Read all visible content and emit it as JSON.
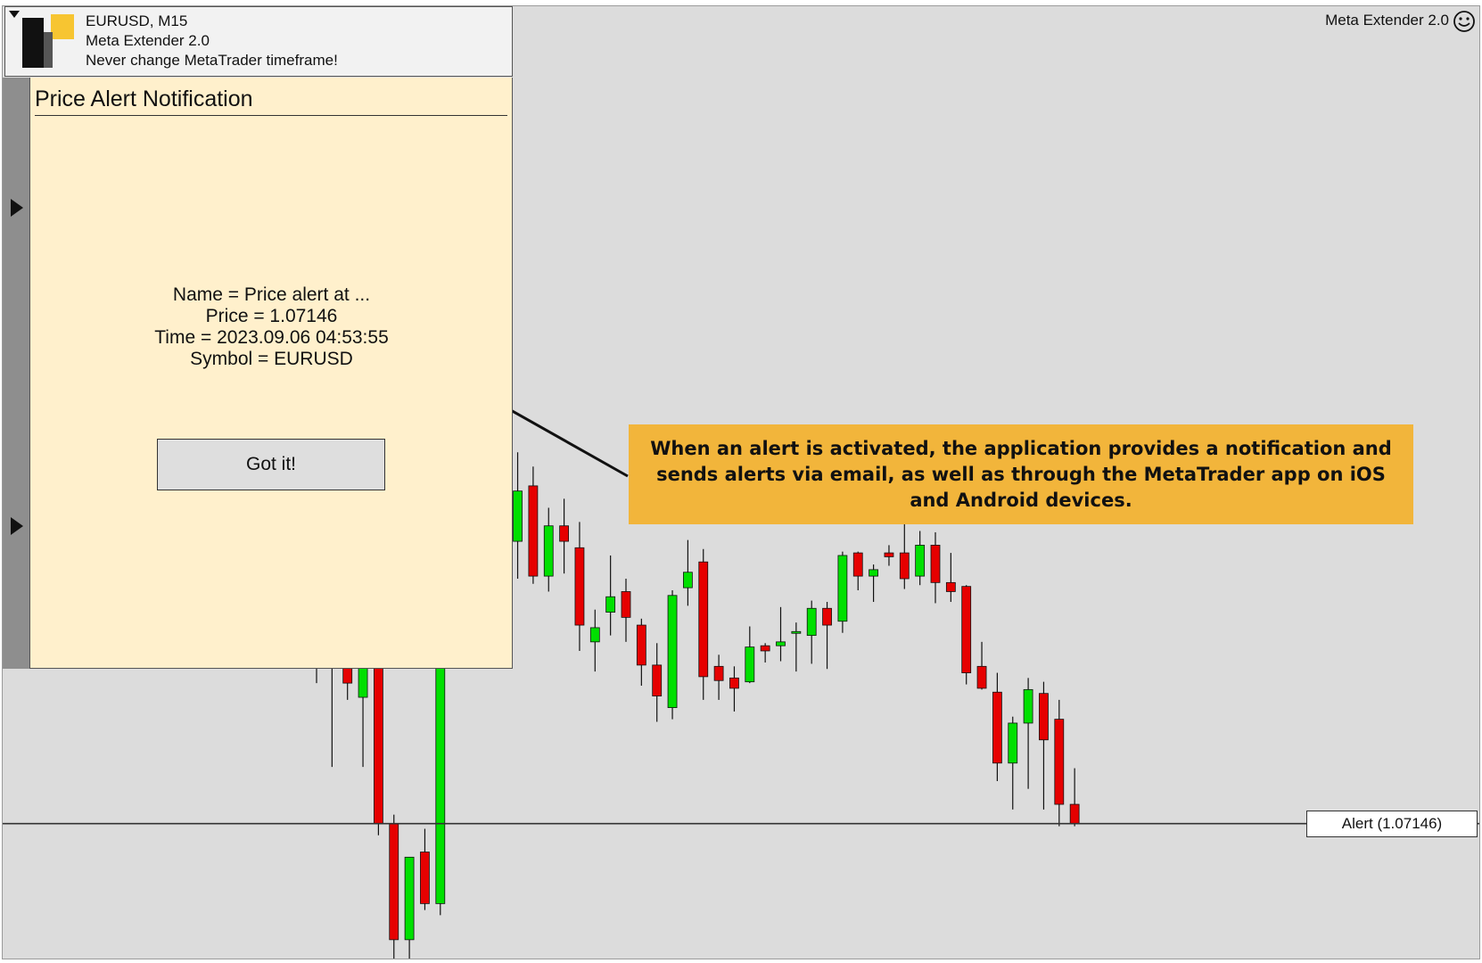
{
  "info_box": {
    "symbol_timeframe": "EURUSD, M15",
    "app_name": "Meta Extender 2.0",
    "tagline": "Never change MetaTrader timeframe!"
  },
  "top_right": {
    "brand": "Meta Extender 2.0",
    "icon": "smiley-icon"
  },
  "alert_panel": {
    "title": "Price Alert Notification",
    "details": [
      "Name = Price alert at ...",
      "Price = 1.07146",
      "Time = 2023.09.06 04:53:55",
      "Symbol = EURUSD"
    ],
    "button_label": "Got it!"
  },
  "callout": {
    "text": "When an alert is activated, the application provides a notification and sends alerts via email, as well as through the MetaTrader app on iOS and Android devices."
  },
  "alert_line": {
    "label": "Alert (1.07146)",
    "price": 1.07146
  },
  "colors": {
    "bull_candle": "#00e000",
    "bear_candle": "#e60000",
    "chart_background": "#dcdcdc",
    "panel_background": "#fff0cc",
    "callout_background": "#f2b53b"
  },
  "chart_data": {
    "type": "candlestick",
    "symbol": "EURUSD",
    "timeframe": "M15",
    "ylim": [
      1.0704,
      1.0778
    ],
    "candles": [
      {
        "o": 1.07368,
        "h": 1.07413,
        "l": 1.07255,
        "c": 1.073
      },
      {
        "o": 1.073,
        "h": 1.0736,
        "l": 1.0719,
        "c": 1.07323
      },
      {
        "o": 1.07379,
        "h": 1.0739,
        "l": 1.07242,
        "c": 1.07255
      },
      {
        "o": 1.07244,
        "h": 1.07322,
        "l": 1.0719,
        "c": 1.07314
      },
      {
        "o": 1.07311,
        "h": 1.07322,
        "l": 1.07137,
        "c": 1.07146
      },
      {
        "o": 1.07146,
        "h": 1.07153,
        "l": 1.0704,
        "c": 1.07056
      },
      {
        "o": 1.07056,
        "h": 1.0712,
        "l": 1.0704,
        "c": 1.0712
      },
      {
        "o": 1.07124,
        "h": 1.07142,
        "l": 1.07079,
        "c": 1.07084
      },
      {
        "o": 1.07084,
        "h": 1.073,
        "l": 1.07075,
        "c": 1.0728
      },
      {
        "o": 1.0728,
        "h": 1.07436,
        "l": 1.07276,
        "c": 1.07368
      },
      {
        "o": 1.07368,
        "h": 1.07414,
        "l": 1.07338,
        "c": 1.07376
      },
      {
        "o": 1.07372,
        "h": 1.07414,
        "l": 1.07343,
        "c": 1.07352
      },
      {
        "o": 1.07354,
        "h": 1.07382,
        "l": 1.07324,
        "c": 1.07365
      },
      {
        "o": 1.07365,
        "h": 1.07434,
        "l": 1.07336,
        "c": 1.07404
      },
      {
        "o": 1.07408,
        "h": 1.07423,
        "l": 1.07332,
        "c": 1.07338
      },
      {
        "o": 1.07338,
        "h": 1.07391,
        "l": 1.07326,
        "c": 1.07377
      },
      {
        "o": 1.07377,
        "h": 1.07398,
        "l": 1.0734,
        "c": 1.07365
      },
      {
        "o": 1.0736,
        "h": 1.0738,
        "l": 1.0728,
        "c": 1.073
      },
      {
        "o": 1.07287,
        "h": 1.07312,
        "l": 1.07264,
        "c": 1.07298
      },
      {
        "o": 1.0731,
        "h": 1.07354,
        "l": 1.07292,
        "c": 1.07322
      },
      {
        "o": 1.07326,
        "h": 1.07336,
        "l": 1.07287,
        "c": 1.07306
      },
      {
        "o": 1.073,
        "h": 1.07305,
        "l": 1.07253,
        "c": 1.07269
      },
      {
        "o": 1.07269,
        "h": 1.07286,
        "l": 1.07225,
        "c": 1.07245
      },
      {
        "o": 1.07236,
        "h": 1.07327,
        "l": 1.07227,
        "c": 1.07323
      },
      {
        "o": 1.07329,
        "h": 1.07366,
        "l": 1.07315,
        "c": 1.07341
      },
      {
        "o": 1.07349,
        "h": 1.07359,
        "l": 1.07242,
        "c": 1.0726
      },
      {
        "o": 1.07268,
        "h": 1.07277,
        "l": 1.07242,
        "c": 1.07257
      },
      {
        "o": 1.07259,
        "h": 1.07268,
        "l": 1.07233,
        "c": 1.07251
      },
      {
        "o": 1.07256,
        "h": 1.07299,
        "l": 1.07255,
        "c": 1.07283
      },
      {
        "o": 1.07284,
        "h": 1.07286,
        "l": 1.07271,
        "c": 1.0728
      },
      {
        "o": 1.07284,
        "h": 1.07314,
        "l": 1.07272,
        "c": 1.07287
      },
      {
        "o": 1.07295,
        "h": 1.07302,
        "l": 1.07264,
        "c": 1.07295
      },
      {
        "o": 1.07292,
        "h": 1.07319,
        "l": 1.0727,
        "c": 1.07313
      },
      {
        "o": 1.07313,
        "h": 1.07318,
        "l": 1.07266,
        "c": 1.073
      },
      {
        "o": 1.07303,
        "h": 1.07357,
        "l": 1.07294,
        "c": 1.07354
      },
      {
        "o": 1.07356,
        "h": 1.07357,
        "l": 1.07327,
        "c": 1.07338
      },
      {
        "o": 1.07338,
        "h": 1.07347,
        "l": 1.07318,
        "c": 1.07343
      },
      {
        "o": 1.07356,
        "h": 1.07362,
        "l": 1.07346,
        "c": 1.07353
      },
      {
        "o": 1.07356,
        "h": 1.07385,
        "l": 1.07328,
        "c": 1.07336
      },
      {
        "o": 1.07338,
        "h": 1.07373,
        "l": 1.07331,
        "c": 1.07362
      },
      {
        "o": 1.07362,
        "h": 1.07372,
        "l": 1.07317,
        "c": 1.07333
      },
      {
        "o": 1.07333,
        "h": 1.07356,
        "l": 1.07318,
        "c": 1.07326
      },
      {
        "o": 1.0733,
        "h": 1.07331,
        "l": 1.07254,
        "c": 1.07263
      },
      {
        "o": 1.07268,
        "h": 1.07287,
        "l": 1.0725,
        "c": 1.07251
      },
      {
        "o": 1.07248,
        "h": 1.07263,
        "l": 1.07179,
        "c": 1.07193
      },
      {
        "o": 1.07193,
        "h": 1.07229,
        "l": 1.07157,
        "c": 1.07224
      },
      {
        "o": 1.07224,
        "h": 1.07259,
        "l": 1.07173,
        "c": 1.0725
      },
      {
        "o": 1.07247,
        "h": 1.07256,
        "l": 1.07157,
        "c": 1.07211
      },
      {
        "o": 1.07227,
        "h": 1.07242,
        "l": 1.07144,
        "c": 1.07161
      },
      {
        "o": 1.07161,
        "h": 1.07189,
        "l": 1.07144,
        "c": 1.07146
      }
    ]
  }
}
